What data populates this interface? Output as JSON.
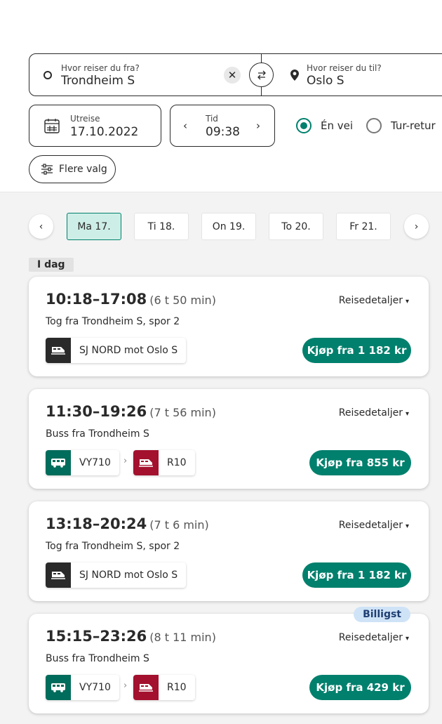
{
  "search": {
    "from_label": "Hvor reiser du fra?",
    "from_value": "Trondheim S",
    "to_label": "Hvor reiser du til?",
    "to_value": "Oslo S",
    "date_label": "Utreise",
    "date_value": "17.10.2022",
    "time_label": "Tid",
    "time_value": "09:38",
    "trip_options": [
      {
        "label": "Én vei",
        "selected": true
      },
      {
        "label": "Tur-retur",
        "selected": false
      }
    ],
    "more_options_label": "Flere valg"
  },
  "days": [
    {
      "label": "Ma 17.",
      "selected": true
    },
    {
      "label": "Ti 18.",
      "selected": false
    },
    {
      "label": "On 19.",
      "selected": false
    },
    {
      "label": "To 20.",
      "selected": false
    },
    {
      "label": "Fr 21.",
      "selected": false
    }
  ],
  "section_label": "I dag",
  "trips": [
    {
      "times": "10:18–17:08",
      "duration": "(6 t 50 min)",
      "details": "Reisedetaljer",
      "from": "Tog fra Trondheim S, spor 2",
      "segments": [
        {
          "type": "train",
          "icon_color": "#2a2a2a",
          "label": "SJ NORD mot Oslo S"
        }
      ],
      "buy": "Kjøp fra 1 182 kr"
    },
    {
      "times": "11:30–19:26",
      "duration": "(7 t 56 min)",
      "details": "Reisedetaljer",
      "from": "Buss fra Trondheim S",
      "segments": [
        {
          "type": "bus",
          "icon_color": "#006c5b",
          "label": "VY710"
        },
        {
          "type": "train",
          "icon_color": "#a3112e",
          "label": "R10"
        }
      ],
      "buy": "Kjøp fra 855 kr"
    },
    {
      "times": "13:18–20:24",
      "duration": "(7 t 6 min)",
      "details": "Reisedetaljer",
      "from": "Tog fra Trondheim S, spor 2",
      "segments": [
        {
          "type": "train",
          "icon_color": "#2a2a2a",
          "label": "SJ NORD mot Oslo S"
        }
      ],
      "buy": "Kjøp fra 1 182 kr"
    },
    {
      "times": "15:15–23:26",
      "duration": "(8 t 11 min)",
      "details": "Reisedetaljer",
      "from": "Buss fra Trondheim S",
      "badge": "Billigst",
      "segments": [
        {
          "type": "bus",
          "icon_color": "#006c5b",
          "label": "VY710"
        },
        {
          "type": "train",
          "icon_color": "#a3112e",
          "label": "R10"
        }
      ],
      "buy": "Kjøp fra 429 kr"
    }
  ],
  "colors": {
    "accent": "#00806d",
    "selected_day_bg": "#cdeee6",
    "badge_bg": "#cfe3f7"
  }
}
